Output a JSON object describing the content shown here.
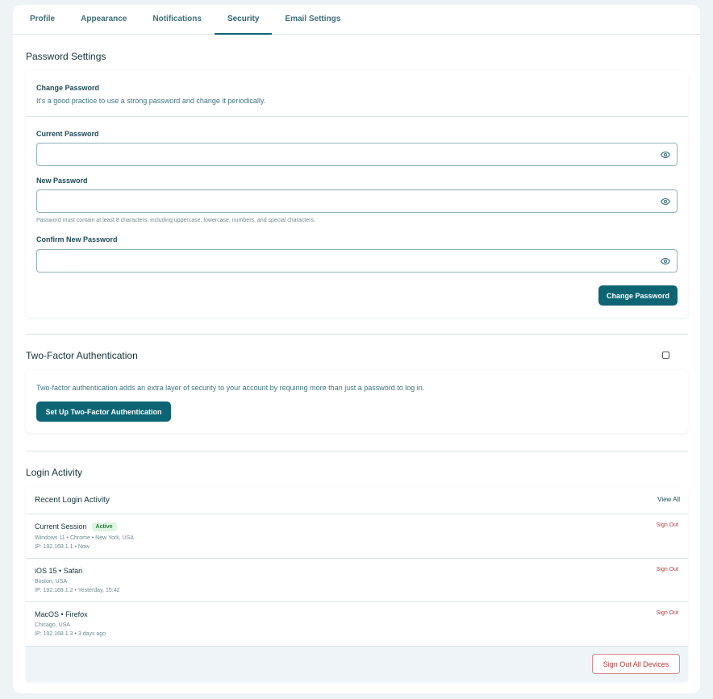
{
  "tabs": [
    "Profile",
    "Appearance",
    "Notifications",
    "Security",
    "Email Settings"
  ],
  "active_tab": "Security",
  "password": {
    "section_title": "Password Settings",
    "change_title": "Change Password",
    "change_desc": "It's a good practice to use a strong password and change it periodically.",
    "current_label": "Current Password",
    "new_label": "New Password",
    "hint": "Password must contain at least 8 characters, including uppercase, lowercase, numbers, and special characters.",
    "confirm_label": "Confirm New Password",
    "button": "Change Password"
  },
  "twofa": {
    "section_title": "Two-Factor Authentication",
    "desc": "Two-factor authentication adds an extra layer of security to your account by requiring more than just a password to log in.",
    "button": "Set Up Two-Factor Authentication",
    "enabled": false
  },
  "activity": {
    "section_title": "Login Activity",
    "recent_title": "Recent Login Activity",
    "view_all": "View All",
    "sessions": [
      {
        "title": "Current Session",
        "badge": "Active",
        "device": "Windows 11 • Chrome • New York, USA",
        "ip": "IP: 192.168.1.1 • Now",
        "action": "Sign Out"
      },
      {
        "title": "iOS 15 • Safari",
        "device": "Boston, USA",
        "ip": "IP: 192.168.1.2 • Yesterday, 15:42",
        "action": "Sign Out"
      },
      {
        "title": "MacOS • Firefox",
        "device": "Chicago, USA",
        "ip": "IP: 192.168.1.3 • 3 days ago",
        "action": "Sign Out"
      }
    ],
    "sign_out_all": "Sign Out All Devices"
  },
  "colors": {
    "accent": "#0d6574",
    "danger": "#b43a3a",
    "active_badge_bg": "#dff5e3"
  },
  "icons": {
    "password_toggle": "eye-icon"
  }
}
